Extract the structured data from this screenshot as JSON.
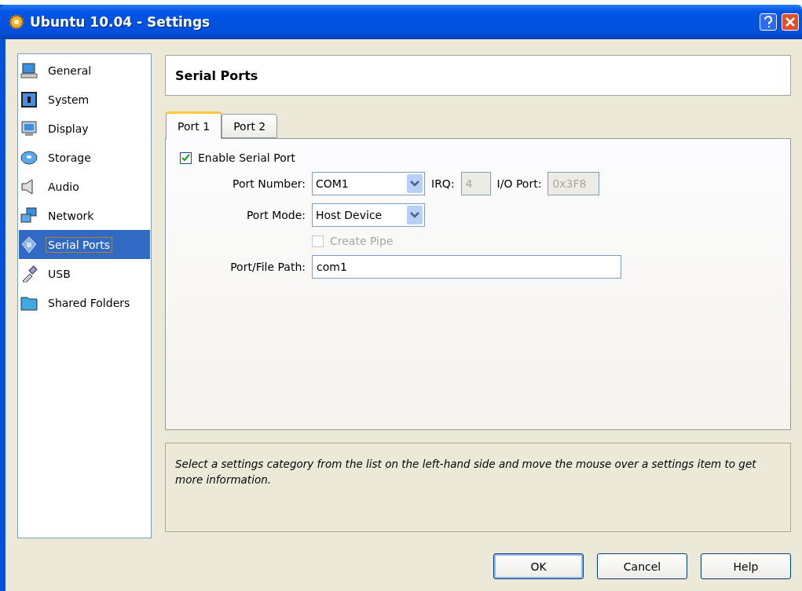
{
  "window": {
    "title": "Ubuntu 10.04 - Settings"
  },
  "sidebar": {
    "items": [
      {
        "label": "General",
        "selected": false
      },
      {
        "label": "System",
        "selected": false
      },
      {
        "label": "Display",
        "selected": false
      },
      {
        "label": "Storage",
        "selected": false
      },
      {
        "label": "Audio",
        "selected": false
      },
      {
        "label": "Network",
        "selected": false
      },
      {
        "label": "Serial Ports",
        "selected": true
      },
      {
        "label": "USB",
        "selected": false
      },
      {
        "label": "Shared Folders",
        "selected": false
      }
    ]
  },
  "page_title": "Serial Ports",
  "tabs": [
    {
      "label": "Port 1",
      "selected": true
    },
    {
      "label": "Port 2",
      "selected": false
    }
  ],
  "enable_serial_port": {
    "label": "Enable Serial Port",
    "checked": true
  },
  "port_number": {
    "label": "Port Number:",
    "value": "COM1"
  },
  "irq": {
    "label": "IRQ:",
    "value": "4",
    "disabled": true
  },
  "io_port": {
    "label": "I/O Port:",
    "value": "0x3F8",
    "disabled": true
  },
  "port_mode": {
    "label": "Port Mode:",
    "value": "Host Device"
  },
  "create_pipe": {
    "label": "Create Pipe",
    "checked": false,
    "disabled": true
  },
  "path": {
    "label": "Port/File Path:",
    "value": "com1"
  },
  "info": "Select a settings category from the list on the left-hand side and move the mouse over a settings item to get more information.",
  "buttons": [
    {
      "label": "OK",
      "default": true
    },
    {
      "label": "Cancel",
      "default": false
    },
    {
      "label": "Help",
      "default": false
    }
  ]
}
